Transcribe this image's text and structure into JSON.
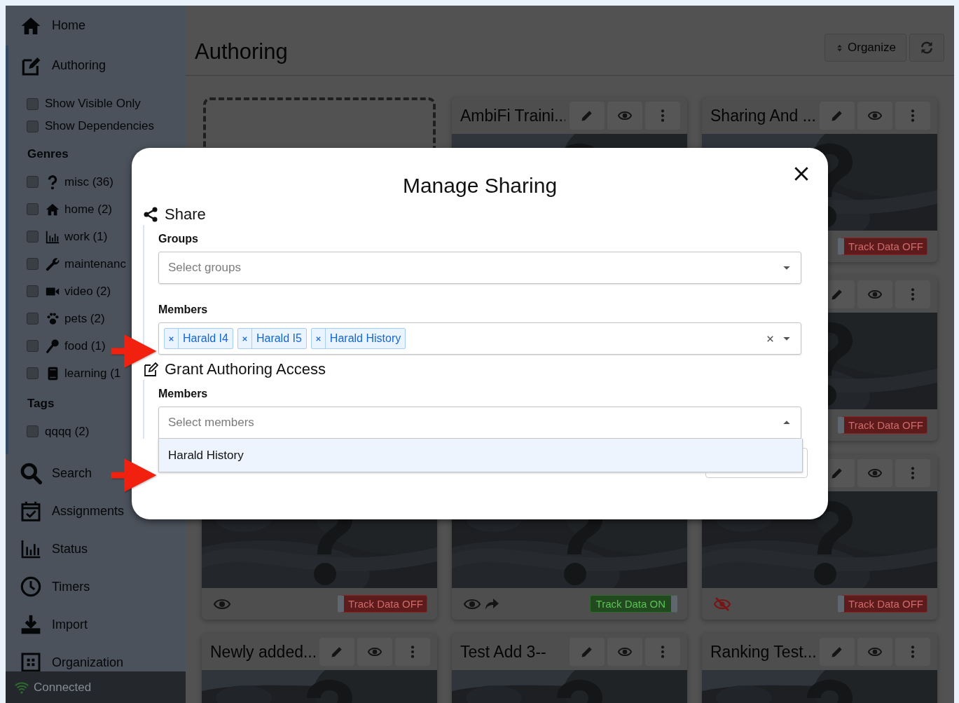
{
  "sidebar": {
    "nav": [
      {
        "label": "Home",
        "selected": false
      },
      {
        "label": "Authoring",
        "selected": true,
        "panel": {
          "options": [
            {
              "label": "Show Visible Only",
              "checked": false
            },
            {
              "label": "Show Dependencies",
              "checked": false
            }
          ],
          "groups": [
            {
              "heading": "Genres",
              "items": [
                {
                  "label": "misc (36)",
                  "checked": false
                },
                {
                  "label": "home (2)",
                  "checked": false
                },
                {
                  "label": "work (1)",
                  "checked": false
                },
                {
                  "label": "maintenanc",
                  "checked": false
                },
                {
                  "label": "video (2)",
                  "checked": false
                },
                {
                  "label": "pets (2)",
                  "checked": false
                },
                {
                  "label": "food (1)",
                  "checked": false
                },
                {
                  "label": "learning (1",
                  "checked": false
                }
              ]
            },
            {
              "heading": "Tags",
              "items": [
                {
                  "label": "qqqq (2)",
                  "checked": false
                }
              ]
            }
          ]
        }
      },
      {
        "label": "Search",
        "selected": false
      },
      {
        "label": "Assignments",
        "selected": false
      },
      {
        "label": "Status",
        "selected": false
      },
      {
        "label": "Timers",
        "selected": false
      },
      {
        "label": "Import",
        "selected": false
      },
      {
        "label": "Organization",
        "selected": false
      }
    ],
    "status": {
      "label": "Connected",
      "connected": true
    }
  },
  "main": {
    "title": "Authoring",
    "organize": {
      "label": "Organize"
    },
    "cards": [
      {
        "kind": "placeholder"
      },
      {
        "kind": "card",
        "title": "AmbiFi Traini...",
        "tools": true
      },
      {
        "kind": "card",
        "title": "Sharing And ...",
        "tools": true,
        "track": {
          "label": "Track Data OFF",
          "on": false
        }
      },
      {
        "kind": "covered"
      },
      {
        "kind": "covered"
      },
      {
        "kind": "card",
        "tools": true,
        "track": {
          "label": "Track Data OFF",
          "on": false
        }
      },
      {
        "kind": "card",
        "visible": true,
        "shared": false,
        "track": {
          "label": "Track Data OFF",
          "on": false
        }
      },
      {
        "kind": "card",
        "visible": true,
        "shared": true,
        "track": {
          "label": "Track Data ON",
          "on": true
        }
      },
      {
        "kind": "card",
        "tools": true,
        "visible": false,
        "shared": false,
        "track": {
          "label": "Track Data OFF",
          "on": false
        }
      },
      {
        "kind": "card",
        "title": "Newly added...",
        "tools": true
      },
      {
        "kind": "card",
        "title": "Test Add 3--",
        "tools": true
      },
      {
        "kind": "card",
        "title": "Ranking Test...",
        "tools": true
      }
    ]
  },
  "dialog": {
    "title": "Manage Sharing",
    "sections": [
      {
        "heading": "Share",
        "fields": [
          {
            "label": "Groups",
            "placeholder": "Select groups",
            "open": false
          },
          {
            "label": "Members",
            "open": false,
            "tags": [
              {
                "label": "Harald I4"
              },
              {
                "label": "Harald I5"
              },
              {
                "label": "Harald History"
              }
            ]
          }
        ]
      },
      {
        "heading": "Grant Authoring Access",
        "fields": [
          {
            "label": "Members",
            "placeholder": "Select members",
            "open": true,
            "options": [
              {
                "label": "Harald History",
                "selected": true
              }
            ]
          }
        ]
      }
    ]
  }
}
